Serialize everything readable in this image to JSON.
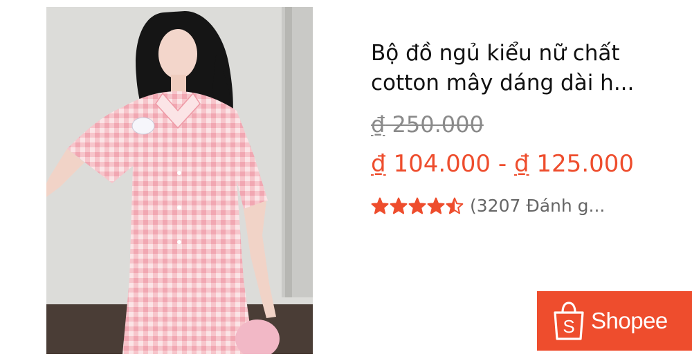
{
  "product": {
    "image_icon": "product-photo-pink-gingham-pajama",
    "title_line1": "Bộ đồ ngủ kiểu nữ chất",
    "title_line2": "cotton mây dáng dài h...",
    "currency_symbol": "₫",
    "original_price": "250.000",
    "price_min": "104.000",
    "price_separator": "-",
    "price_max": "125.000",
    "rating": 4.5,
    "rating_max": 5,
    "review_text": "(3207 Đánh g..."
  },
  "brand": {
    "name": "Shopee",
    "bag_letter": "S",
    "color": "#ee4d2d"
  },
  "colors": {
    "price": "#ee4d2d",
    "original_price": "#8a8a8a",
    "title": "#111111",
    "star": "#ee4d2d"
  }
}
